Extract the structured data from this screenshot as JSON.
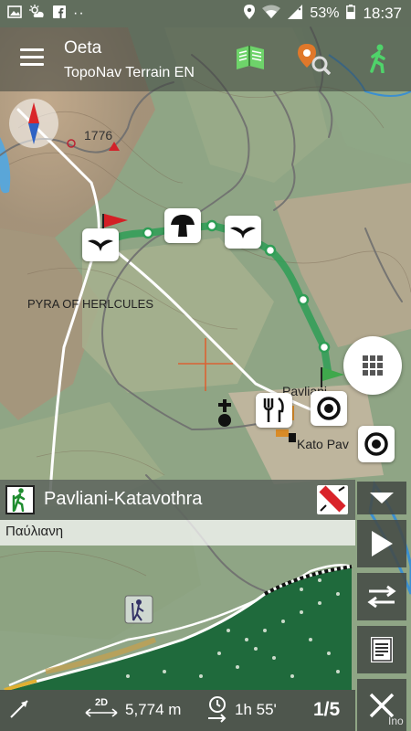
{
  "status": {
    "battery": "53%",
    "time": "18:37",
    "dots": "··"
  },
  "app": {
    "title": "Oeta",
    "subtitle": "TopoNav Terrain EN"
  },
  "map": {
    "peak_elevation": "1776",
    "label_pyra": "PYRA OF HERLCULES",
    "label_pavliani": "Pavliani",
    "label_kato": "Kato Pav",
    "route_color": "#2f9e56"
  },
  "route": {
    "name": "Pavliani-Katavothra",
    "sub_label": "Παύλιανη"
  },
  "stats": {
    "distance_badge": "2D",
    "distance": "5,774 m",
    "duration": "1h 55'",
    "page": "1/5"
  },
  "corner_text": "Ino"
}
